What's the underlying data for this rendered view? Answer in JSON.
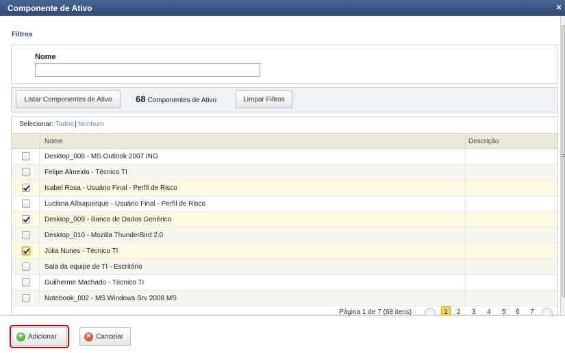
{
  "dialog": {
    "title": "Componente de Ativo",
    "close_symbol": "×"
  },
  "filters": {
    "section_label": "Filtros",
    "name_label": "Nome",
    "name_value": "",
    "name_placeholder": ""
  },
  "toolbar": {
    "list_button": "Listar Componentes de Ativo",
    "count": "68",
    "count_label": "Componentes de Ativo",
    "clear_button": "Limpar Filtros"
  },
  "grid": {
    "select_label": "Selecionar:",
    "select_all": "Todos",
    "select_sep": "|",
    "select_none": "Nenhum",
    "columns": {
      "name": "Nome",
      "description": "Descrição"
    },
    "rows": [
      {
        "name": "Desktop_008 - MS Outlook 2007 ING",
        "checked": false,
        "focus": false,
        "bg": "#ffffff"
      },
      {
        "name": "Felipe Almeida - Técnico TI",
        "checked": false,
        "focus": false,
        "bg": "#f6f5ee"
      },
      {
        "name": "Isabel Rosa - Usuário Final - Perfil de Risco",
        "checked": true,
        "focus": false,
        "bg": "#fdf9e2"
      },
      {
        "name": "Luciana Albuquerque - Usuário Final - Perfil de Risco",
        "checked": false,
        "focus": false,
        "bg": "#ffffff"
      },
      {
        "name": "Desktop_009 - Banco de Dados Genérico",
        "checked": true,
        "focus": false,
        "bg": "#fdf9e2"
      },
      {
        "name": "Desktop_010 - Mozilla ThunderBird 2.0",
        "checked": false,
        "focus": false,
        "bg": "#f6f5ee"
      },
      {
        "name": "Júlia Nunes - Técnico TI",
        "checked": true,
        "focus": true,
        "bg": "#fdf9e2"
      },
      {
        "name": "Sala da equipe de TI - Escritório",
        "checked": false,
        "focus": false,
        "bg": "#f6f5ee"
      },
      {
        "name": "Guilherme Machado - Técnico TI",
        "checked": false,
        "focus": false,
        "bg": "#ffffff"
      },
      {
        "name": "Notebook_002 - MS Windows Srv 2008 MS",
        "checked": false,
        "focus": false,
        "bg": "#f6f5ee"
      }
    ],
    "pager": {
      "info": "Página 1 de 7 (68 itens)",
      "current": "1",
      "pages": [
        "2",
        "3",
        "4",
        "5",
        "6",
        "7"
      ]
    }
  },
  "footer": {
    "add_button": "Adicionar",
    "cancel_button": "Cancelar"
  },
  "colors": {
    "title_bar": "#2f4a72",
    "link": "#5b8ec6",
    "highlight_outline": "#cc0000"
  }
}
